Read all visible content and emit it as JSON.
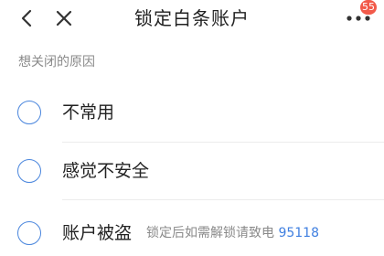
{
  "header": {
    "title": "锁定白条账户",
    "back_icon": "chevron-left-icon",
    "close_icon": "close-icon",
    "more_icon": "more-dots-icon",
    "badge_count": "55",
    "badge_color": "#f25a4a"
  },
  "section": {
    "label": "想关闭的原因"
  },
  "options": [
    {
      "label": "不常用"
    },
    {
      "label": "感觉不安全"
    },
    {
      "label": "账户被盗",
      "hint_text": "锁定后如需解锁请致电 ",
      "hint_phone": "95118"
    }
  ],
  "colors": {
    "accent": "#4a86dd",
    "link": "#3f7fe0",
    "text": "#222222",
    "muted": "#8a8a8a"
  }
}
